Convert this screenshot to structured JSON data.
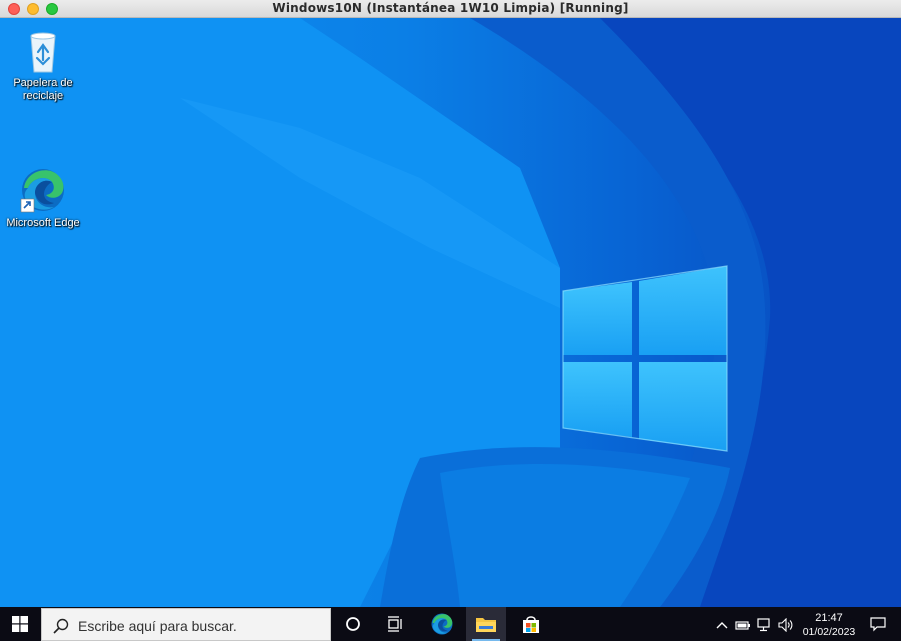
{
  "window": {
    "title": "Windows10N (Instantánea 1W10 Limpia) [Running]"
  },
  "desktop": {
    "icons": [
      {
        "label_line1": "Papelera de",
        "label_line2": "reciclaje",
        "icon": "recycle-bin-icon"
      },
      {
        "label": "Microsoft Edge",
        "icon": "edge-icon"
      }
    ]
  },
  "taskbar": {
    "search_placeholder": "Escribe aquí para buscar.",
    "time": "21:47",
    "date": "01/02/2023",
    "pinned": [
      "cortana-icon",
      "task-view-icon",
      "edge-icon",
      "file-explorer-icon",
      "store-icon"
    ],
    "tray": [
      "chevron-up-icon",
      "battery-icon",
      "network-icon",
      "volume-icon",
      "notification-icon"
    ]
  },
  "colors": {
    "wallpaper_light": "#0f8ff2",
    "wallpaper_dark": "#0a4cc0",
    "taskbar": "#0b0b14"
  }
}
